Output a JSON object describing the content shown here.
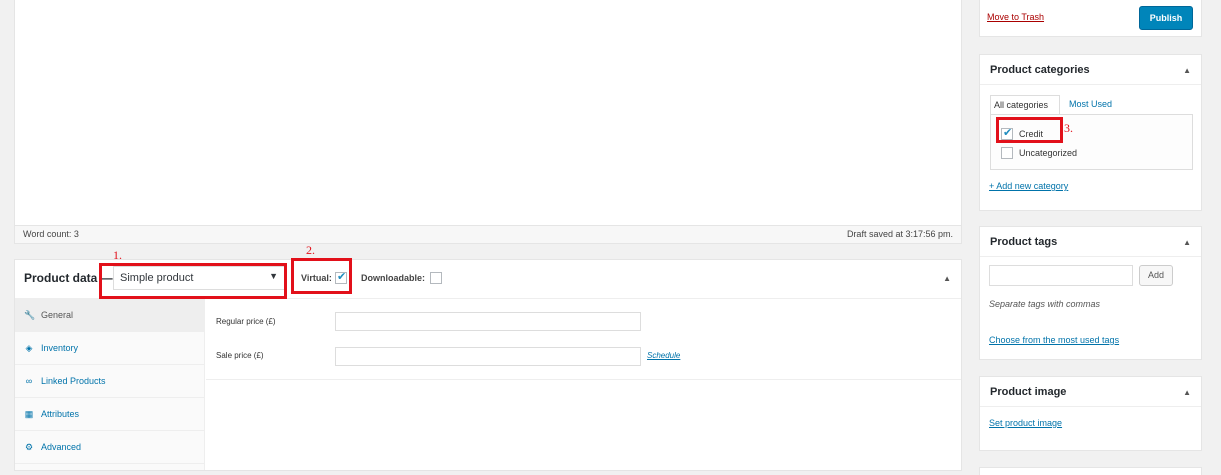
{
  "editor": {
    "word_count": "Word count: 3",
    "draft_saved": "Draft saved at 3:17:56 pm."
  },
  "product_data": {
    "title": "Product data —",
    "type_select": "Simple product",
    "virtual_label": "Virtual:",
    "downloadable_label": "Downloadable:",
    "virtual_checked": true,
    "downloadable_checked": false,
    "tabs": [
      {
        "label": "General",
        "icon": "wrench-icon"
      },
      {
        "label": "Inventory",
        "icon": "tag-icon"
      },
      {
        "label": "Linked Products",
        "icon": "link-icon"
      },
      {
        "label": "Attributes",
        "icon": "table-icon"
      },
      {
        "label": "Advanced",
        "icon": "gear-icon"
      }
    ],
    "regular_price_label": "Regular price (£)",
    "sale_price_label": "Sale price (£)",
    "schedule_link": "Schedule"
  },
  "annotations": {
    "one": "1.",
    "two": "2.",
    "three": "3."
  },
  "publish_box": {
    "trash_link": "Move to Trash",
    "publish_button": "Publish"
  },
  "categories": {
    "title": "Product categories",
    "tab_all": "All categories",
    "tab_most_used": "Most Used",
    "items": [
      {
        "label": "Credit",
        "checked": true
      },
      {
        "label": "Uncategorized",
        "checked": false
      }
    ],
    "add_new": "+ Add new category"
  },
  "tags": {
    "title": "Product tags",
    "add_button": "Add",
    "hint": "Separate tags with commas",
    "choose_link": "Choose from the most used tags"
  },
  "image": {
    "title": "Product image",
    "set_link": "Set product image"
  },
  "colors": {
    "accent": "#0073aa",
    "annotation": "#e2101a",
    "publish": "#0085ba"
  }
}
